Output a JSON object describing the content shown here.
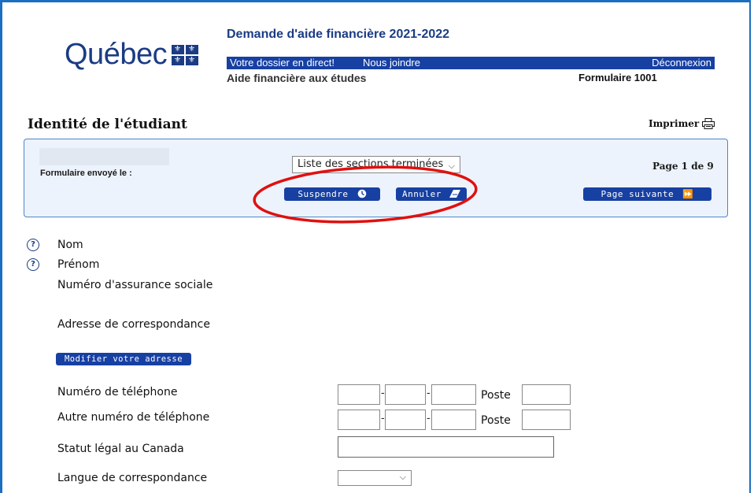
{
  "header": {
    "logo_text": "Québec",
    "app_title": "Demande d'aide financière 2021-2022",
    "nav_links": [
      "Votre dossier en direct!",
      "Nous joindre"
    ],
    "logout": "Déconnexion",
    "subtitle": "Aide financière aux études",
    "form_number": "Formulaire 1001"
  },
  "page": {
    "title": "Identité de l'étudiant",
    "print_label": "Imprimer"
  },
  "toolbar": {
    "sent_label": "Formulaire envoyé le :",
    "sections_select": "Liste des sections terminées",
    "page_indicator": "Page 1 de 9",
    "suspend": "Suspendre",
    "cancel": "Annuler",
    "next": "Page suivante"
  },
  "form": {
    "nom": "Nom",
    "prenom": "Prénom",
    "nas": "Numéro d'assurance sociale",
    "address": "Adresse de correspondance",
    "modify_address": "Modifier votre adresse",
    "phone": "Numéro de téléphone",
    "alt_phone": "Autre numéro de téléphone",
    "poste": "Poste",
    "legal_status": "Statut légal au Canada",
    "language": "Langue de correspondance"
  },
  "colors": {
    "brand_blue": "#1b3c84",
    "button_blue": "#1740a3",
    "panel_bg": "#edf3fc",
    "annotation_red": "#e01010"
  },
  "icons": [
    "flag-icon",
    "printer-icon",
    "clock-icon",
    "eraser-icon",
    "double-arrow-icon",
    "help-icon",
    "chevron-down-icon"
  ]
}
